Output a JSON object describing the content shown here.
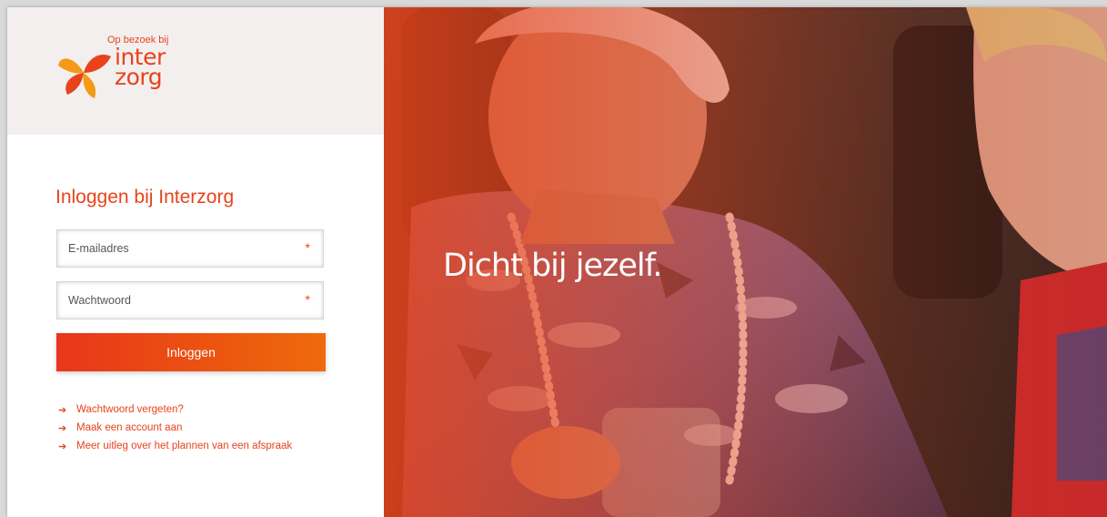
{
  "brand": {
    "tagline": "Op bezoek bij",
    "word_line1": "inter",
    "word_line2": "zorg",
    "color": "#e8431a"
  },
  "login": {
    "title": "Inloggen bij Interzorg",
    "email_placeholder": "E-mailadres",
    "password_placeholder": "Wachtwoord",
    "required_marker": "*",
    "submit_label": "Inloggen"
  },
  "links": [
    {
      "label": "Wachtwoord vergeten?"
    },
    {
      "label": "Maak een account aan"
    },
    {
      "label": "Meer uitleg over het plannen van een afspraak"
    }
  ],
  "hero": {
    "slogan": "Dicht bij jezelf."
  },
  "icons": {
    "logo": "interzorg-flower-mark",
    "link_arrow": "arrow-right-icon"
  }
}
